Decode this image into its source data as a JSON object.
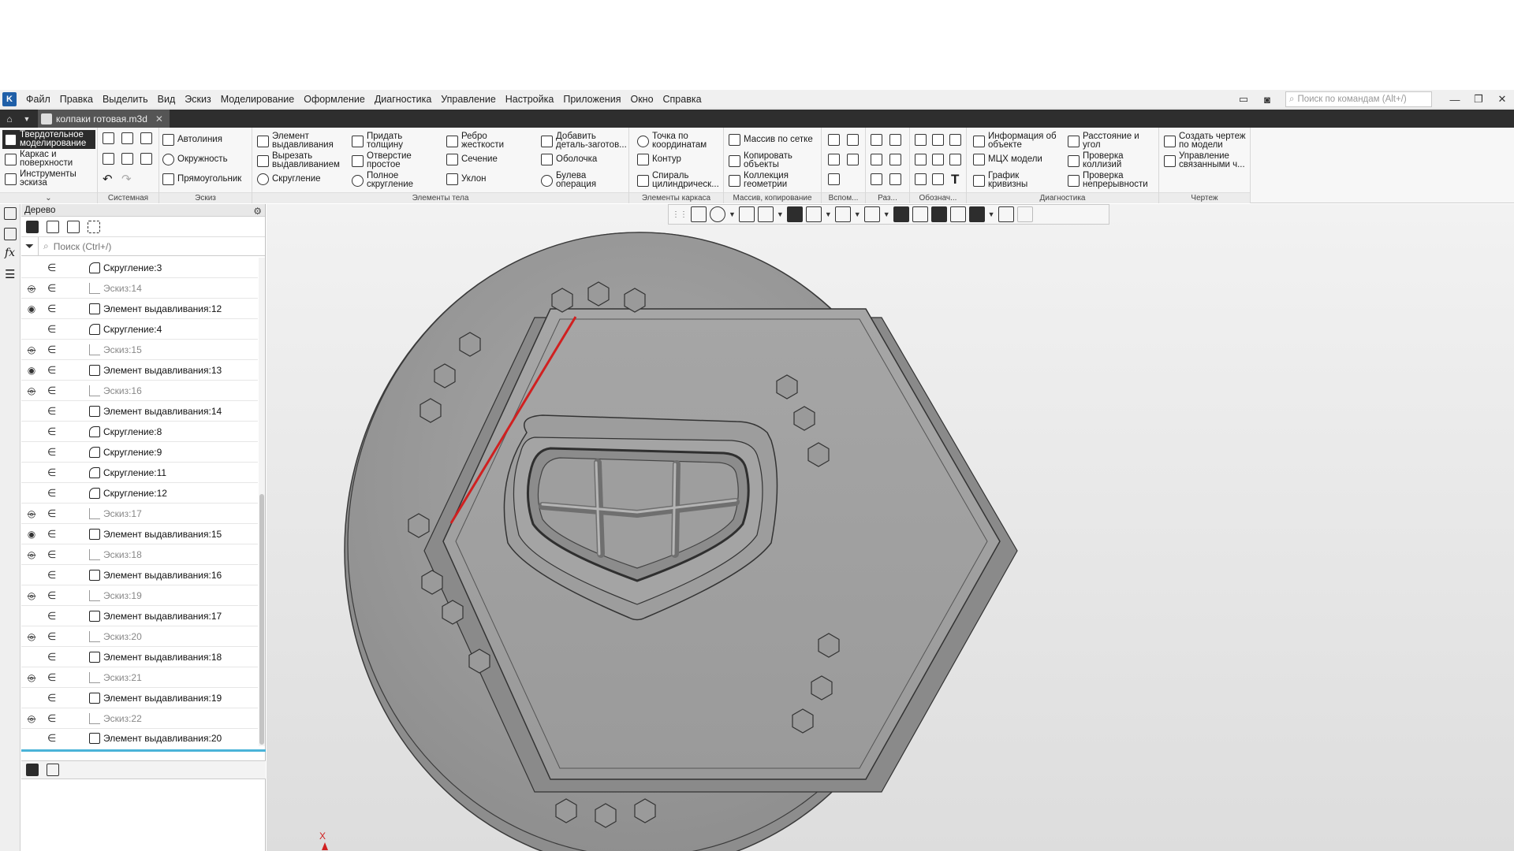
{
  "menu": {
    "items": [
      "Файл",
      "Правка",
      "Выделить",
      "Вид",
      "Эскиз",
      "Моделирование",
      "Оформление",
      "Диагностика",
      "Управление",
      "Настройка",
      "Приложения",
      "Окно",
      "Справка"
    ],
    "search_placeholder": "Поиск по командам (Alt+/)"
  },
  "tabs": {
    "document": "колпаки готовая.m3d"
  },
  "ribbon": {
    "modes": [
      "Твердотельное\nмоделирование",
      "Каркас и\nповерхности",
      "Инструменты\nэскиза"
    ],
    "sketch_items": [
      "Автолиния",
      "Окружность",
      "Прямоугольник"
    ],
    "body_items": [
      "Элемент\nвыдавливания",
      "Вырезать\nвыдавливанием",
      "Скругление",
      "Придать\nтолщину",
      "Отверстие\nпростое",
      "Полное\nскругление",
      "Ребро\nжесткости",
      "Сечение",
      "Уклон",
      "Добавить\nдеталь-заготов...",
      "Оболочка",
      "Булева\nоперация"
    ],
    "frame_items": [
      "Точка по\nкоординатам",
      "Контур",
      "Спираль\nцилиндрическ..."
    ],
    "array_items": [
      "Массив по сетке",
      "Копировать\nобъекты",
      "Коллекция\nгеометрии"
    ],
    "diag_items": [
      "Информация об\nобъекте",
      "МЦХ модели",
      "График\nкривизны",
      "Расстояние и\nугол",
      "Проверка\nколлизий",
      "Проверка\nнепрерывности"
    ],
    "drawing_items": [
      "Создать чертеж\nпо модели",
      "Управление\nсвязанными ч..."
    ],
    "captions": {
      "system": "Системная",
      "sketch": "Эскиз",
      "body": "Элементы тела",
      "frame": "Элементы каркаса",
      "array": "Массив, копирование",
      "aux": "Вспом...",
      "sizes": "Раз...",
      "marks": "Обознач...",
      "diag": "Диагностика",
      "drawing": "Чертеж"
    }
  },
  "tree": {
    "title": "Дерево",
    "search_placeholder": "Поиск (Ctrl+/)",
    "rows": [
      {
        "label": "Скругление:3",
        "eye": "",
        "kind": "fillet",
        "dim": false
      },
      {
        "label": "Эскиз:14",
        "eye": "hidden",
        "kind": "sketch",
        "dim": true
      },
      {
        "label": "Элемент выдавливания:12",
        "eye": "visible",
        "kind": "extrude",
        "dim": false
      },
      {
        "label": "Скругление:4",
        "eye": "",
        "kind": "fillet",
        "dim": false
      },
      {
        "label": "Эскиз:15",
        "eye": "hidden",
        "kind": "sketch",
        "dim": true
      },
      {
        "label": "Элемент выдавливания:13",
        "eye": "visible",
        "kind": "extrude",
        "dim": false
      },
      {
        "label": "Эскиз:16",
        "eye": "hidden",
        "kind": "sketch",
        "dim": true
      },
      {
        "label": "Элемент выдавливания:14",
        "eye": "",
        "kind": "extrude",
        "dim": false
      },
      {
        "label": "Скругление:8",
        "eye": "",
        "kind": "fillet",
        "dim": false
      },
      {
        "label": "Скругление:9",
        "eye": "",
        "kind": "fillet",
        "dim": false
      },
      {
        "label": "Скругление:11",
        "eye": "",
        "kind": "fillet",
        "dim": false
      },
      {
        "label": "Скругление:12",
        "eye": "",
        "kind": "fillet",
        "dim": false
      },
      {
        "label": "Эскиз:17",
        "eye": "hidden",
        "kind": "sketch",
        "dim": true
      },
      {
        "label": "Элемент выдавливания:15",
        "eye": "visible",
        "kind": "extrude",
        "dim": false
      },
      {
        "label": "Эскиз:18",
        "eye": "hidden",
        "kind": "sketch",
        "dim": true
      },
      {
        "label": "Элемент выдавливания:16",
        "eye": "",
        "kind": "extrude",
        "dim": false
      },
      {
        "label": "Эскиз:19",
        "eye": "hidden",
        "kind": "sketch",
        "dim": true
      },
      {
        "label": "Элемент выдавливания:17",
        "eye": "",
        "kind": "extrude",
        "dim": false
      },
      {
        "label": "Эскиз:20",
        "eye": "hidden",
        "kind": "sketch",
        "dim": true
      },
      {
        "label": "Элемент выдавливания:18",
        "eye": "",
        "kind": "extrude",
        "dim": false
      },
      {
        "label": "Эскиз:21",
        "eye": "hidden",
        "kind": "sketch",
        "dim": true
      },
      {
        "label": "Элемент выдавливания:19",
        "eye": "",
        "kind": "extrude",
        "dim": false
      },
      {
        "label": "Эскиз:22",
        "eye": "hidden",
        "kind": "sketch",
        "dim": true
      },
      {
        "label": "Элемент выдавливания:20",
        "eye": "",
        "kind": "extrude",
        "dim": false,
        "selected": true
      }
    ]
  },
  "viewport": {
    "axis_label": "X"
  },
  "colors": {
    "accent": "#4ab3d8",
    "highlight_edge": "#d02020",
    "ribbon_dark": "#2b2b2b"
  }
}
